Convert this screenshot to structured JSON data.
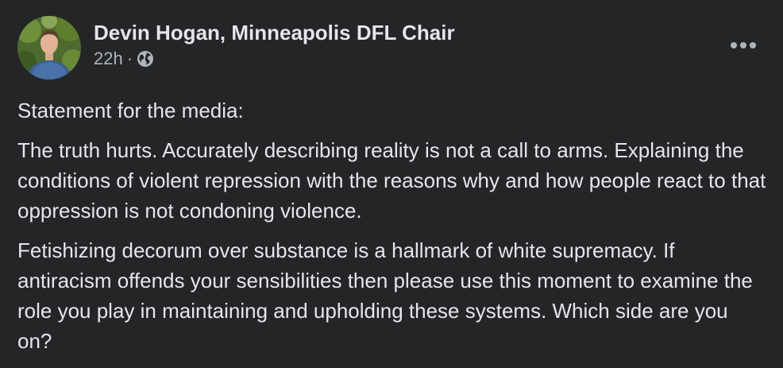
{
  "post": {
    "author": "Devin Hogan, Minneapolis DFL Chair",
    "timestamp": "22h",
    "separator": "·",
    "audience_icon": "globe-icon",
    "more_icon": "more-options-icon",
    "paragraphs": [
      "Statement for the media:",
      "The truth hurts. Accurately describing reality is not a call to arms. Explaining the conditions of violent repression with the reasons why and how people react to that oppression is not condoning violence.",
      "Fetishizing decorum over substance is a hallmark of white supremacy. If antiracism offends your sensibilities then please use this moment to examine the role you play in maintaining and upholding these systems. Which side are you on?"
    ]
  },
  "colors": {
    "background": "#242526",
    "primary_text": "#e4e6eb",
    "secondary_text": "#b0b3b8"
  }
}
